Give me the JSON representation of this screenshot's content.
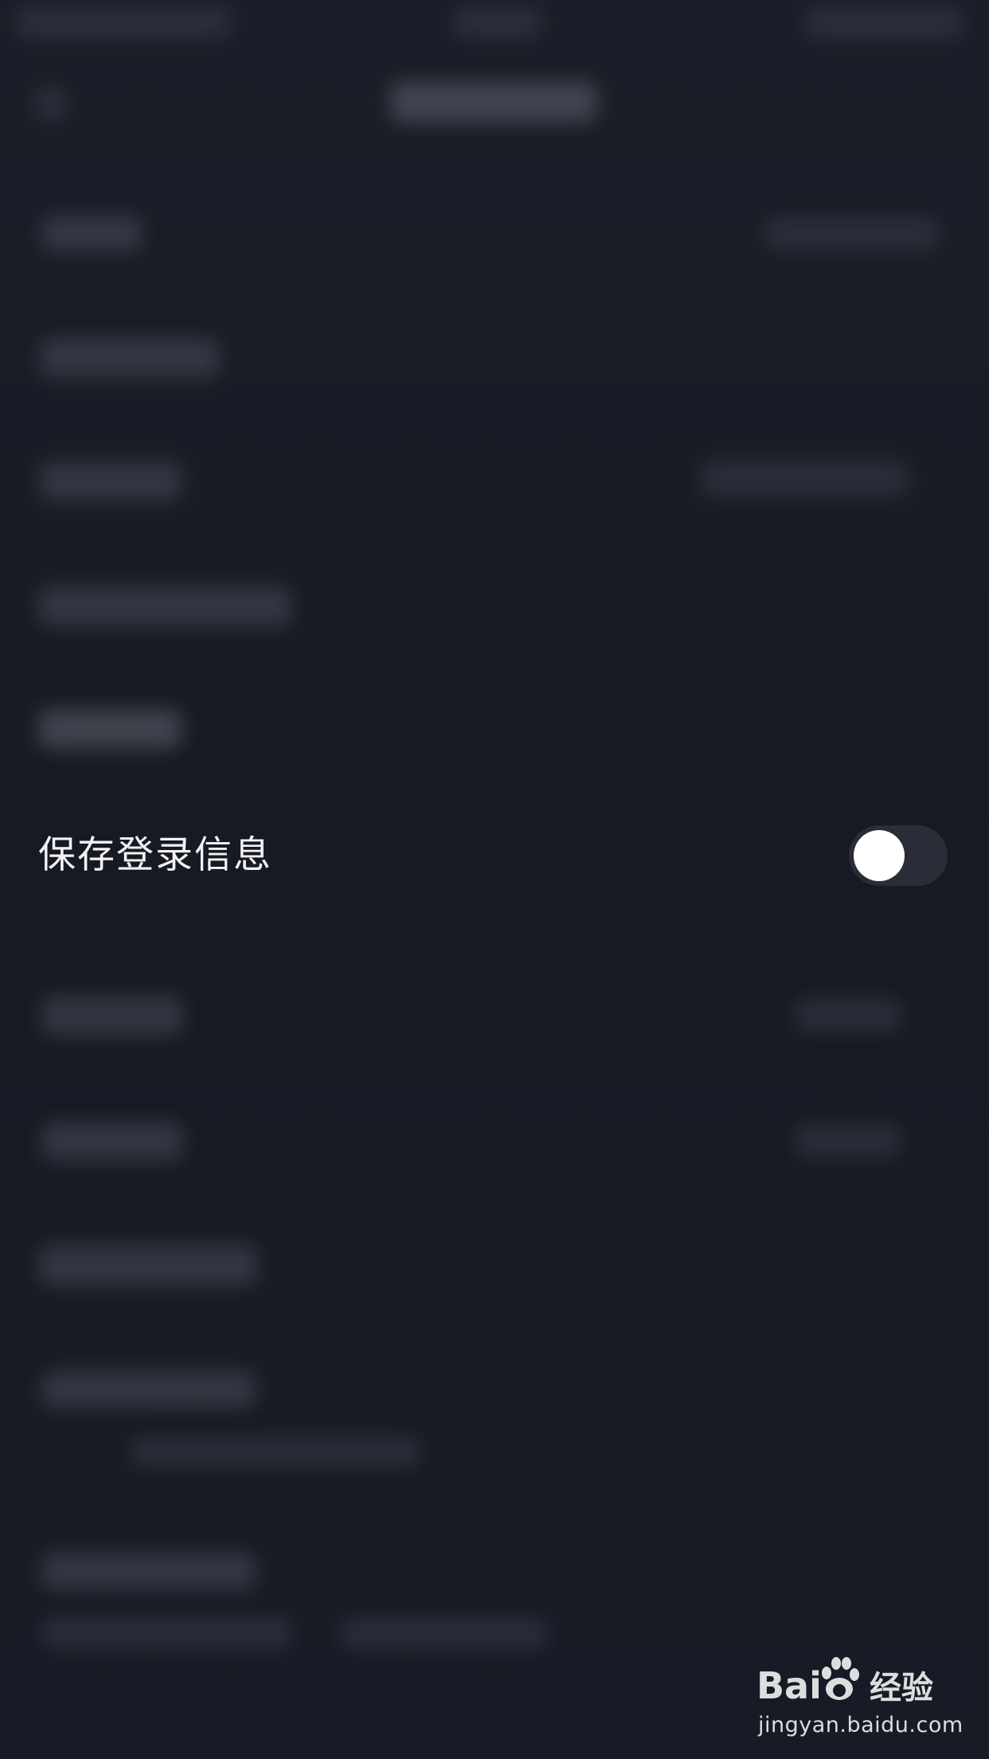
{
  "settings": {
    "save_login_label": "保存登录信息",
    "save_login_enabled": false
  },
  "watermark": {
    "logo_text": "Bai 经验",
    "url": "jingyan.baidu.com"
  },
  "colors": {
    "background": "#171a24",
    "toggle_track_off": "#2a2d38",
    "toggle_knob": "#ffffff",
    "text": "#f2f2f4"
  }
}
